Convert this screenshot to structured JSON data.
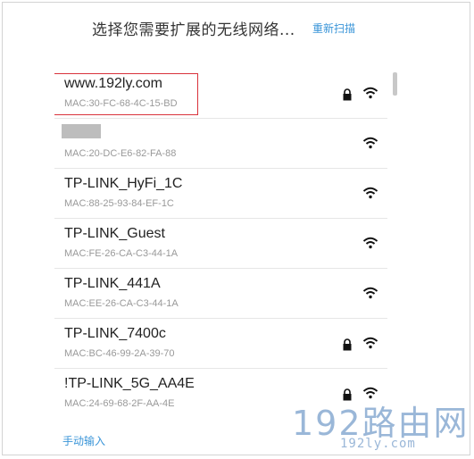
{
  "header": {
    "title": "选择您需要扩展的无线网络...",
    "rescan_label": "重新扫描"
  },
  "networks": [
    {
      "ssid": "www.192ly.com",
      "mac": "MAC:30-FC-68-4C-15-BD",
      "locked": true
    },
    {
      "ssid": "",
      "mac": "MAC:20-DC-E6-82-FA-88",
      "locked": false
    },
    {
      "ssid": "TP-LINK_HyFi_1C",
      "mac": "MAC:88-25-93-84-EF-1C",
      "locked": false
    },
    {
      "ssid": "TP-LINK_Guest",
      "mac": "MAC:FE-26-CA-C3-44-1A",
      "locked": false
    },
    {
      "ssid": "TP-LINK_441A",
      "mac": "MAC:EE-26-CA-C3-44-1A",
      "locked": false
    },
    {
      "ssid": "TP-LINK_7400c",
      "mac": "MAC:BC-46-99-2A-39-70",
      "locked": true
    },
    {
      "ssid": "!TP-LINK_5G_AA4E",
      "mac": "MAC:24-69-68-2F-AA-4E",
      "locked": true
    }
  ],
  "footer": {
    "manual_label": "手动输入"
  },
  "watermark": {
    "big": "192路由网",
    "small": "192ly.com"
  },
  "icons": {
    "lock": "lock-icon",
    "wifi": "wifi-signal-icon"
  },
  "colors": {
    "link": "#3a95d8",
    "highlight": "#d9323b",
    "watermark": "#9ab7d8"
  }
}
